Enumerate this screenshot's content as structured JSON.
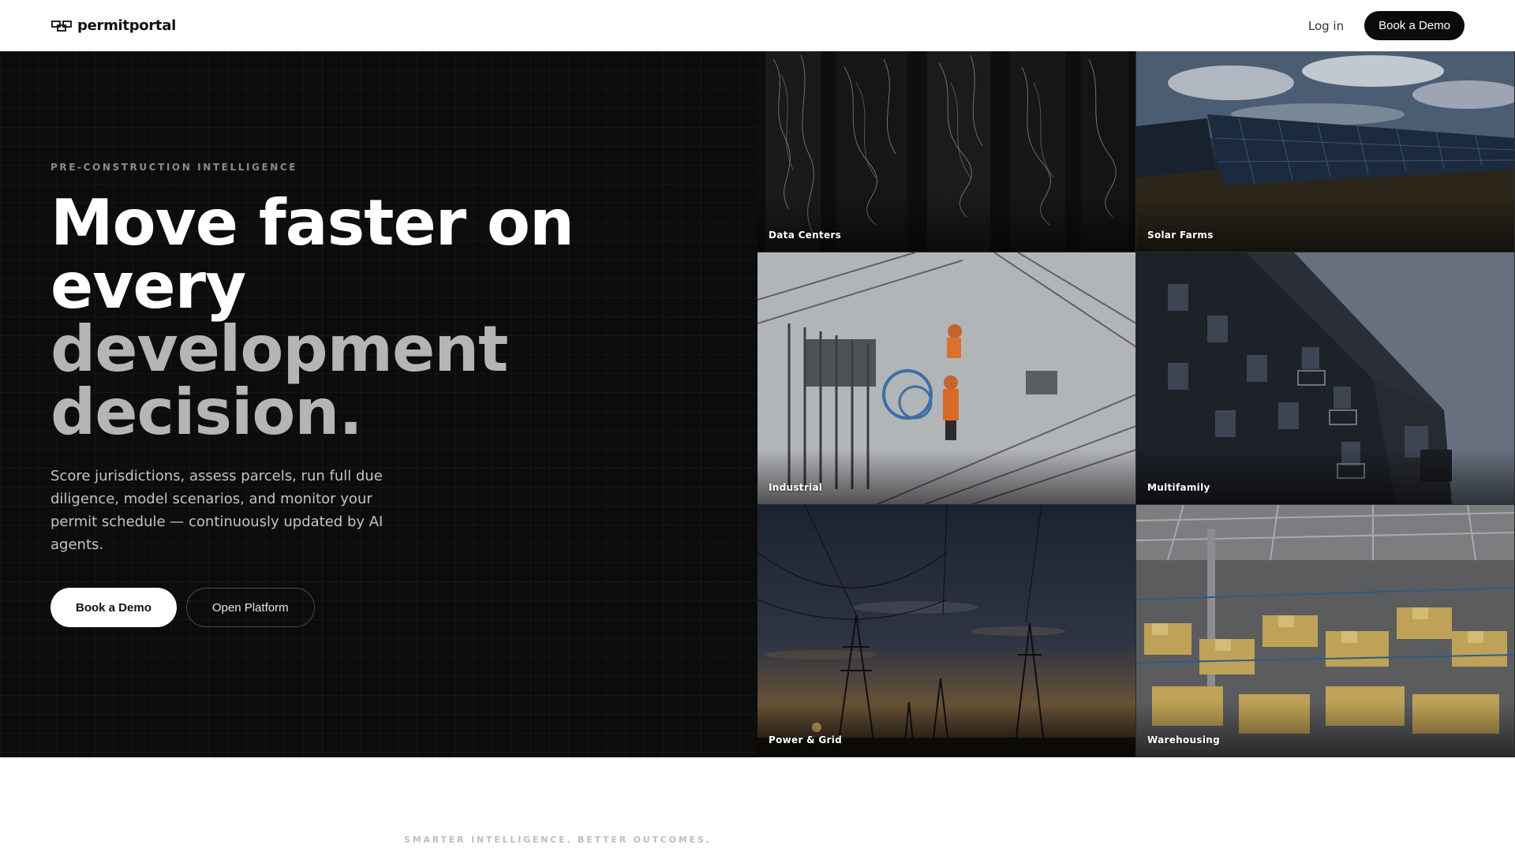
{
  "nav": {
    "brand": "permitportal",
    "login_label": "Log in",
    "demo_label": "Book a Demo"
  },
  "hero": {
    "eyebrow": "PRE-CONSTRUCTION INTELLIGENCE",
    "headline_line1": "Move faster on",
    "headline_line2": "every",
    "headline_line3": "development",
    "headline_line4": "decision.",
    "subtext": "Score jurisdictions, assess parcels, run full due diligence, model scenarios, and monitor your permit schedule — continuously updated by AI agents.",
    "primary_cta": "Book a Demo",
    "secondary_cta": "Open Platform"
  },
  "tiles": [
    {
      "label": "Data Centers"
    },
    {
      "label": "Solar Farms"
    },
    {
      "label": "Industrial"
    },
    {
      "label": "Multifamily"
    },
    {
      "label": "Power & Grid"
    },
    {
      "label": "Warehousing"
    }
  ],
  "section": {
    "eyebrow": "SMARTER INTELLIGENCE. BETTER OUTCOMES."
  },
  "colors": {
    "hero_bg": "#0c0c0c",
    "headline_primary": "#ffffff",
    "headline_muted": "#b5b5b5",
    "button_dark": "#0b0b0b"
  }
}
